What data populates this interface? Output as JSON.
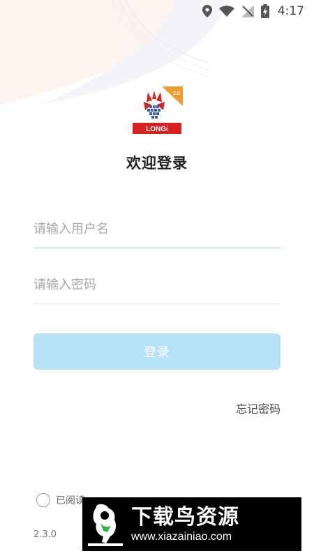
{
  "status_bar": {
    "time": "4:17"
  },
  "logo": {
    "brand_text": "LONGi",
    "badge_text": "2.0"
  },
  "login": {
    "title": "欢迎登录",
    "username_placeholder": "请输入用户名",
    "password_placeholder": "请输入密码",
    "submit_label": "登录",
    "forgot_label": "忘记密码"
  },
  "agreement": {
    "text": "已阅读"
  },
  "footer": {
    "version": "2.3.0"
  },
  "watermark": {
    "title": "下载鸟资源",
    "url": "www.xiazainiao.com"
  },
  "colors": {
    "brand_red": "#d7221f",
    "badge_orange": "#f29a2e",
    "login_button": "#b7e0f9",
    "active_underline": "#8fcaf0",
    "placeholder": "#a8a8a8"
  },
  "icons": [
    "location-icon",
    "wifi-icon",
    "no-signal-icon",
    "battery-charging-icon"
  ]
}
